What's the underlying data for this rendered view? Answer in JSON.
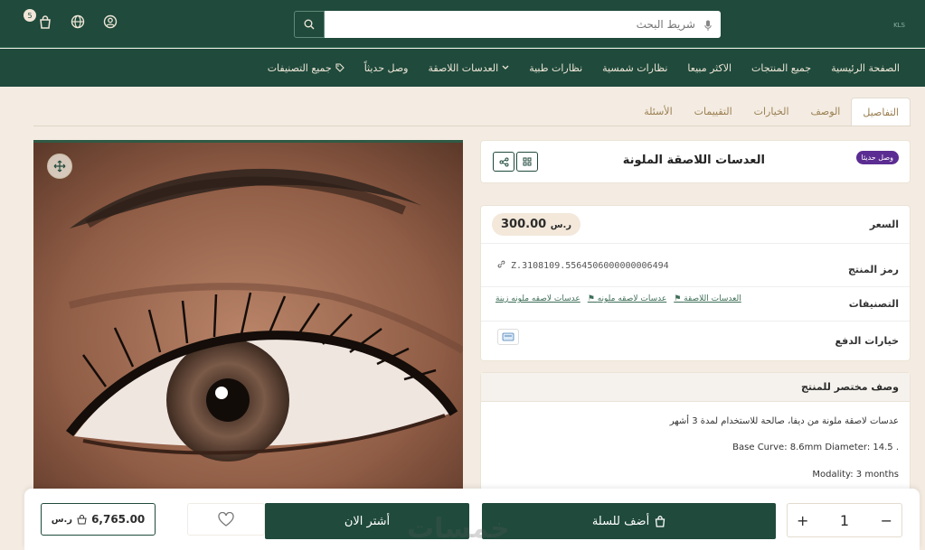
{
  "header": {
    "cart_count": "5",
    "search_placeholder": "شريط البحث",
    "logo_text": "KLS"
  },
  "nav": {
    "items": [
      {
        "label": "الصفحة الرئيسية"
      },
      {
        "label": "جميع المنتجات"
      },
      {
        "label": "الاكثر مبيعا"
      },
      {
        "label": "نظارات شمسية"
      },
      {
        "label": "نظارات طبية"
      },
      {
        "label": "العدسات اللاصقة"
      },
      {
        "label": "وصل حديثاً"
      },
      {
        "label": "جميع التصنيفات"
      }
    ]
  },
  "tabs": [
    {
      "label": "التفاصيل",
      "active": true
    },
    {
      "label": "الوصف"
    },
    {
      "label": "الخيارات"
    },
    {
      "label": "التقييمات"
    },
    {
      "label": "الأسئلة"
    }
  ],
  "product": {
    "badge": "وصل حديثا",
    "title": "العدسات اللاصقة الملونة",
    "price_label": "السعر",
    "price": "300.00",
    "currency": "ر.س",
    "sku_label": "رمز المنتج",
    "sku": "Z.3108109.5564506000000006494",
    "categories_label": "التصنيفات",
    "categories": [
      "العدسات اللاصقة",
      "عدسات لاصقه ملونه",
      "عدسات لاصقه ملونه زينة"
    ],
    "payment_label": "خيارات الدفع"
  },
  "description": {
    "title": "وصف مختصر للمنتج",
    "lines": [
      "عدسات لاصقة ملونة من ديفا، صالحة للاستخدام لمدة 3 أشهر",
      "Base Curve: 8.6mm Diameter: 14.5 .",
      "Modality: 3 months"
    ]
  },
  "footer": {
    "total": "6,765.00",
    "buy_now": "أشتر الان",
    "add_to_cart": "أضف للسلة",
    "quantity": "1",
    "plus": "+",
    "minus": "−"
  },
  "watermark": "خمسات",
  "colors": {
    "primary": "#1f4a3c",
    "background": "#f4ece2",
    "badge": "#5b2c91",
    "tab_text": "#9a7f52"
  }
}
